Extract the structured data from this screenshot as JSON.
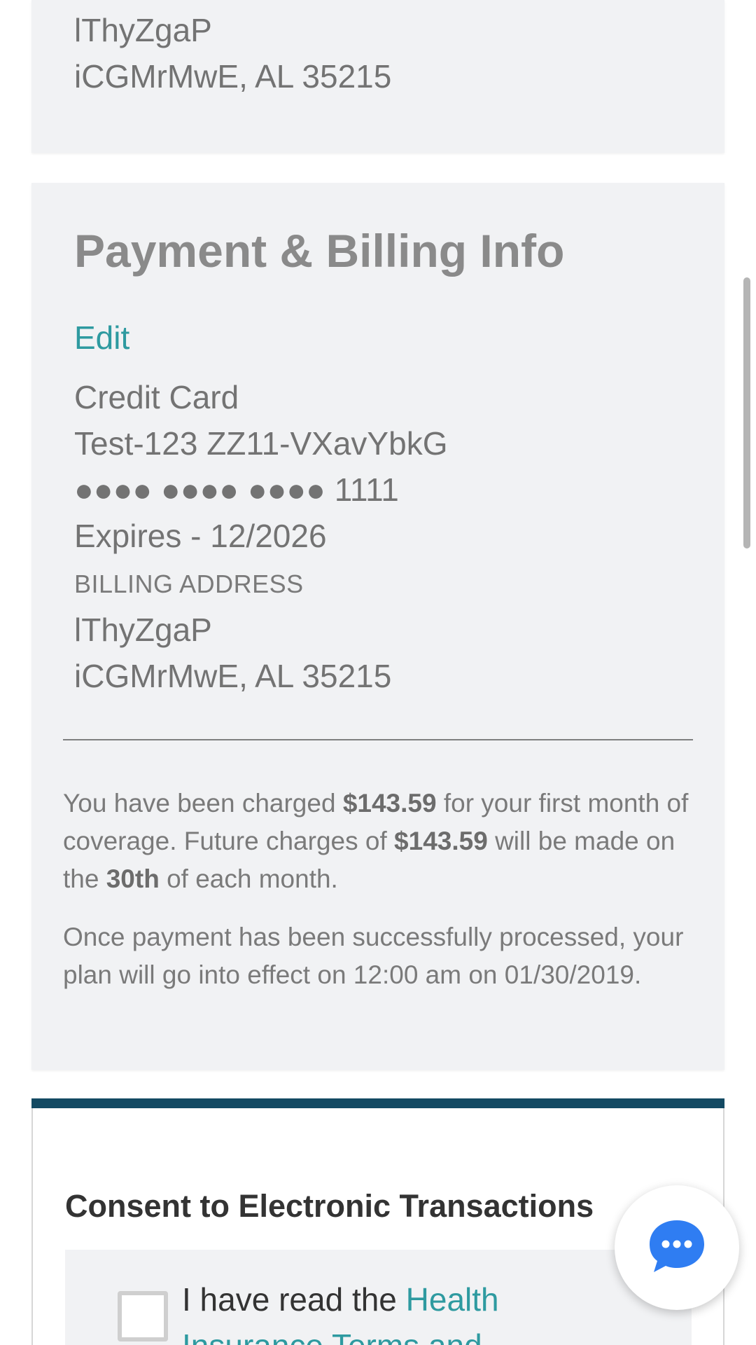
{
  "shipping_address": {
    "line1": "lThyZgaP",
    "line2": "iCGMrMwE, AL 35215"
  },
  "payment": {
    "title": "Payment & Billing Info",
    "edit_label": "Edit",
    "method": "Credit Card",
    "card_name": "Test-123 ZZ11-VXavYbkG",
    "card_number": "●●●● ●●●● ●●●● 1111",
    "expires": "Expires - 12/2026",
    "billing_heading": "BILLING ADDRESS",
    "billing_line1": "lThyZgaP",
    "billing_line2": "iCGMrMwE, AL 35215"
  },
  "charges": {
    "p1_a": "You have been charged ",
    "p1_amount1": "$143.59",
    "p1_b": " for your first month of coverage. Future charges of ",
    "p1_amount2": "$143.59",
    "p1_c": " will be made on the ",
    "p1_day": "30th",
    "p1_d": " of each month.",
    "p2": "Once payment has been successfully processed, your plan will go into effect on 12:00 am on 01/30/2019."
  },
  "consent": {
    "title": "Consent to Electronic Transactions",
    "text_prefix": "I have read the ",
    "link_text": "Health Insurance Terms and"
  },
  "colors": {
    "accent_teal": "#2e9aa0",
    "header_bar": "#134a63",
    "chat_blue": "#2f7df2"
  },
  "icons": {
    "chat": "chat-bubble-icon"
  }
}
